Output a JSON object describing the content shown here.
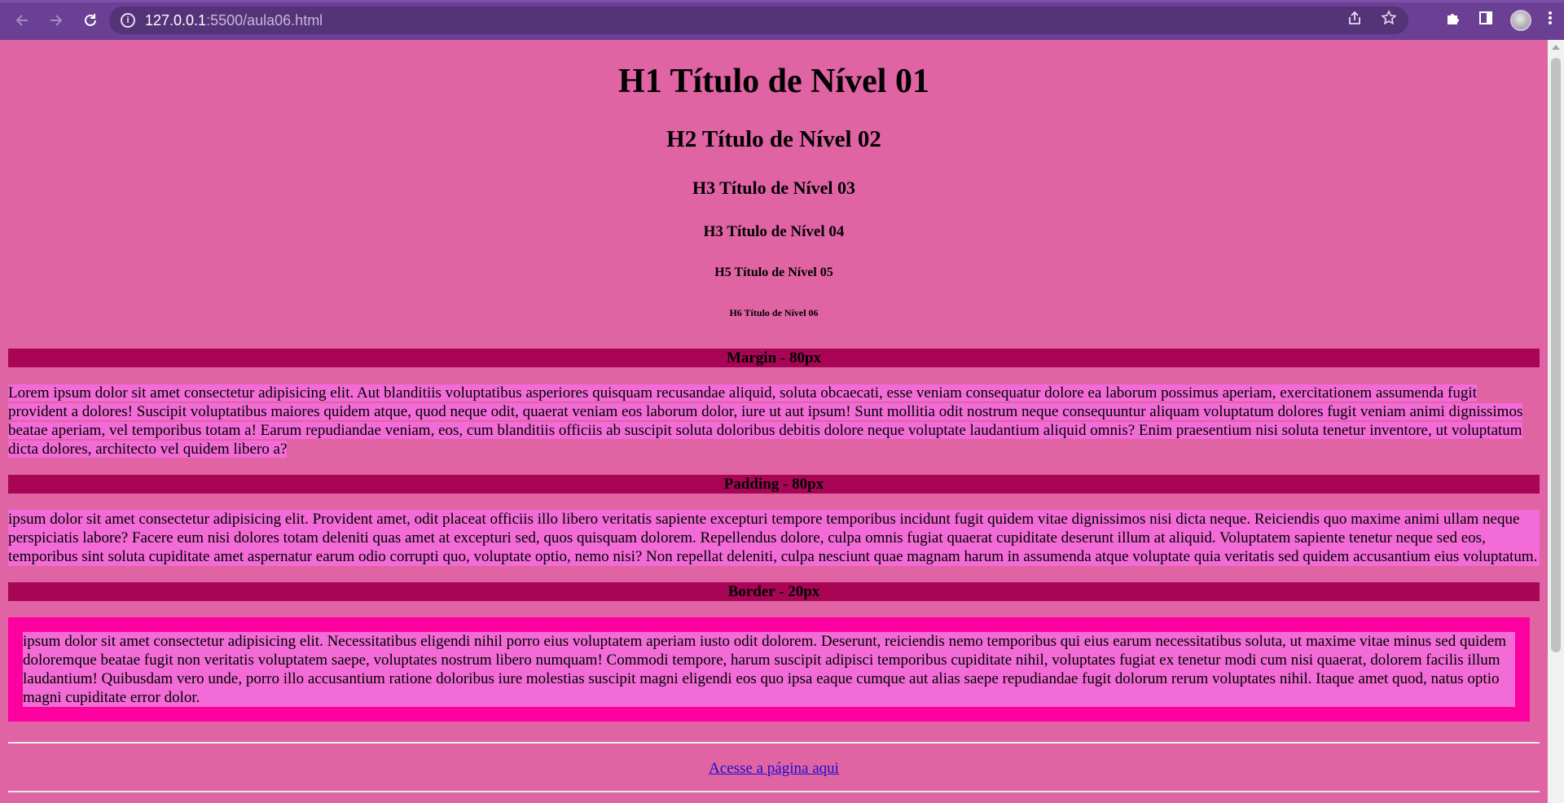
{
  "browser": {
    "url_host": "127.0.0.1",
    "url_rest": ":5500/aula06.html"
  },
  "headings": {
    "h1": "H1 Título de Nível 01",
    "h2": "H2 Título de Nível 02",
    "h3": "H3 Título de Nível 03",
    "h4": "H3 Título de Nível 04",
    "h5": "H5 Título de Nível 05",
    "h6": "H6 Título de Nível 06"
  },
  "sections": [
    {
      "title": "Margin - 80px",
      "text": "Lorem ipsum dolor sit amet consectetur adipisicing elit. Aut blanditiis voluptatibus asperiores quisquam recusandae aliquid, soluta obcaecati, esse veniam consequatur dolore ea laborum possimus aperiam, exercitationem assumenda fugit provident a dolores! Suscipit voluptatibus maiores quidem atque, quod neque odit, quaerat veniam eos laborum dolor, iure ut aut ipsum! Sunt mollitia odit nostrum neque consequuntur aliquam voluptatum dolores fugit veniam animi dignissimos beatae aperiam, vel temporibus totam a! Earum repudiandae veniam, eos, cum blanditiis officiis ab suscipit soluta doloribus debitis dolore neque voluptate laudantium aliquid omnis? Enim praesentium nisi soluta tenetur inventore, ut voluptatum dicta dolores, architecto vel quidem libero a?"
    },
    {
      "title": "Padding - 80px",
      "text": "ipsum dolor sit amet consectetur adipisicing elit. Provident amet, odit placeat officiis illo libero veritatis sapiente excepturi tempore temporibus incidunt fugit quidem vitae dignissimos nisi dicta neque. Reiciendis quo maxime animi ullam neque perspiciatis labore? Facere eum nisi dolores totam deleniti quas amet at excepturi sed, quos quisquam dolorem. Repellendus dolore, culpa omnis fugiat quaerat cupiditate deserunt illum at aliquid. Voluptatem sapiente tenetur neque sed eos, temporibus sint soluta cupiditate amet aspernatur earum odio corrupti quo, voluptate optio, nemo nisi? Non repellat deleniti, culpa nesciunt quae magnam harum in assumenda atque voluptate quia veritatis sed quidem accusantium eius voluptatum."
    },
    {
      "title": "Border - 20px",
      "text": "ipsum dolor sit amet consectetur adipisicing elit. Necessitatibus eligendi nihil porro eius voluptatem aperiam iusto odit dolorem. Deserunt, reiciendis nemo temporibus qui eius earum necessitatibus soluta, ut maxime vitae minus sed quidem doloremque beatae fugit non veritatis voluptatem saepe, voluptates nostrum libero numquam! Commodi tempore, harum suscipit adipisci temporibus cupiditate nihil, voluptates fugiat ex tenetur modi cum nisi quaerat, dolorem facilis illum laudantium! Quibusdam vero unde, porro illo accusantium ratione doloribus iure molestias suscipit magni eligendi eos quo ipsa eaque cumque aut alias saepe repudiandae fugit dolorum rerum voluptates nihil. Itaque amet quod, natus optio magni cupiditate error dolor."
    }
  ],
  "link": {
    "label": "Acesse a página aqui"
  },
  "icons": {
    "back": "arrow-left-icon",
    "forward": "arrow-right-icon",
    "reload": "reload-icon",
    "info": "info-icon",
    "share": "share-icon",
    "bookmark": "star-icon",
    "extensions": "puzzle-icon",
    "sidepanel": "side-panel-icon",
    "profile": "avatar",
    "menu": "kebab-menu-icon"
  },
  "colors": {
    "page_bg": "#e063a4",
    "section_bar": "#a80556",
    "paragraph_bg": "#f26bd6",
    "border": "#ff00a0",
    "chrome": "#6a3f94"
  }
}
